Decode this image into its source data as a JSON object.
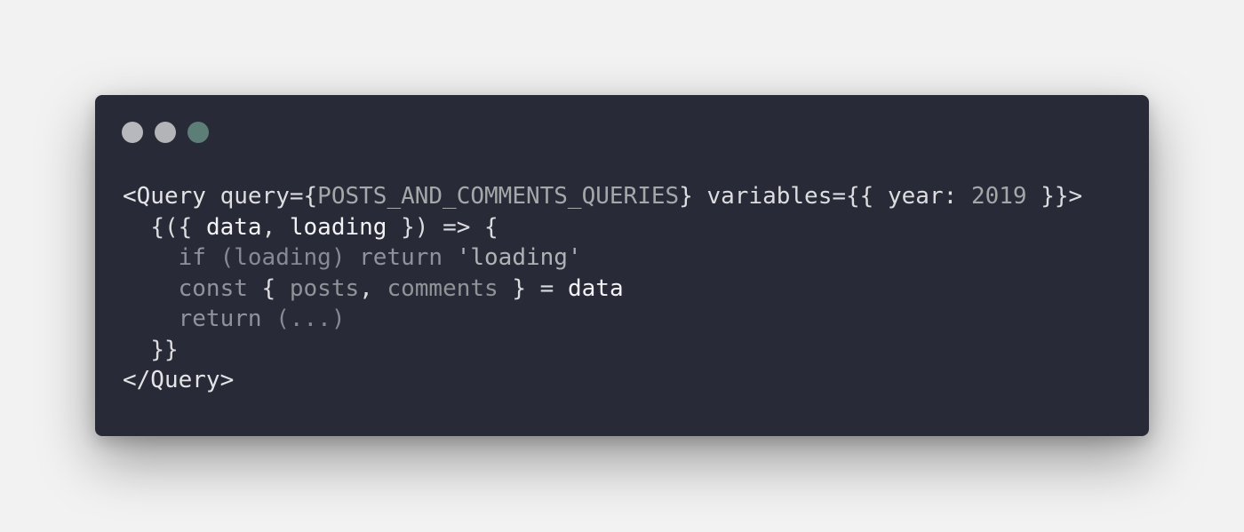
{
  "window": {
    "controls": [
      {
        "name": "close-button",
        "color": "#b7b8bc"
      },
      {
        "name": "minimize-button",
        "color": "#b2b4b7"
      },
      {
        "name": "zoom-button",
        "color": "#5d7e76"
      }
    ]
  },
  "code": {
    "lines": [
      [
        {
          "t": "<Query",
          "c": "tag"
        },
        {
          "t": " ",
          "c": "punct"
        },
        {
          "t": "query",
          "c": "attr"
        },
        {
          "t": "={",
          "c": "punct"
        },
        {
          "t": "POSTS_AND_COMMENTS_QUERIES",
          "c": "const"
        },
        {
          "t": "} ",
          "c": "punct"
        },
        {
          "t": "variables",
          "c": "attr"
        },
        {
          "t": "={{ ",
          "c": "punct"
        },
        {
          "t": "year",
          "c": "attr"
        },
        {
          "t": ": ",
          "c": "punct"
        },
        {
          "t": "2019",
          "c": "num"
        },
        {
          "t": " }}>",
          "c": "punct"
        }
      ],
      [
        {
          "t": "  ",
          "c": "punct"
        },
        {
          "t": "{({ ",
          "c": "punct"
        },
        {
          "t": "data",
          "c": "var"
        },
        {
          "t": ", ",
          "c": "punct"
        },
        {
          "t": "loading",
          "c": "var"
        },
        {
          "t": " }) => {",
          "c": "punct"
        }
      ],
      [
        {
          "t": "    ",
          "c": "punct"
        },
        {
          "t": "if",
          "c": "kw"
        },
        {
          "t": " (loading) ",
          "c": "dim"
        },
        {
          "t": "return",
          "c": "kw"
        },
        {
          "t": " ",
          "c": "punct"
        },
        {
          "t": "'loading'",
          "c": "str"
        }
      ],
      [
        {
          "t": "    ",
          "c": "punct"
        },
        {
          "t": "const",
          "c": "kw"
        },
        {
          "t": " { ",
          "c": "punct"
        },
        {
          "t": "posts",
          "c": "prop"
        },
        {
          "t": ", ",
          "c": "punct"
        },
        {
          "t": "comments",
          "c": "prop"
        },
        {
          "t": " } = ",
          "c": "punct"
        },
        {
          "t": "data",
          "c": "var"
        }
      ],
      [
        {
          "t": "    ",
          "c": "punct"
        },
        {
          "t": "return",
          "c": "kw"
        },
        {
          "t": " (...)",
          "c": "dim"
        }
      ],
      [
        {
          "t": "  ",
          "c": "punct"
        },
        {
          "t": "}}",
          "c": "punct"
        }
      ],
      [
        {
          "t": "</Query>",
          "c": "tag"
        }
      ]
    ]
  }
}
